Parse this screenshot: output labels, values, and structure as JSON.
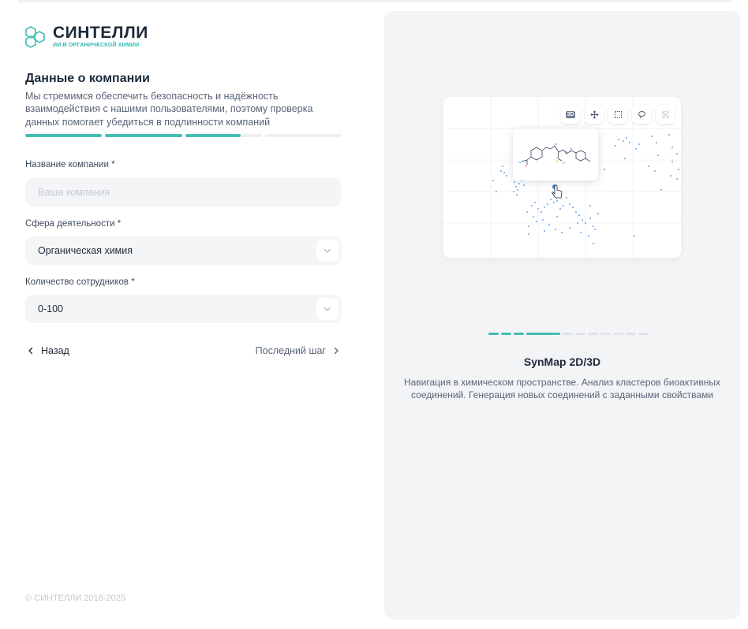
{
  "brand": {
    "name": "СИНТЕЛЛИ",
    "tagline": "ИИ В ОРГАНИЧЕСКОЙ ХИМИИ",
    "accent": "#43bdb2"
  },
  "form": {
    "title": "Данные о компании",
    "description": "Мы стремимся обеспечить безопасность и надёжность взаимодействия с нашими пользователями, поэтому проверка данных помогает убедиться в подлинности компаний",
    "progress": [
      1,
      1,
      0.73,
      0
    ],
    "company_name": {
      "label": "Название компании *",
      "placeholder": "Ваша компания",
      "value": ""
    },
    "industry": {
      "label": "Сфера деятельности *",
      "value": "Органическая химия"
    },
    "employees": {
      "label": "Количество сотрудников *",
      "value": "0-100"
    },
    "back_label": "Назад",
    "next_label": "Последний шаг"
  },
  "footer": {
    "copyright": "© СИНТЕЛЛИ 2018-2025"
  },
  "showcase": {
    "toolbar": {
      "badge_3d": "3D",
      "icons": [
        "3d-toggle-icon",
        "move-icon",
        "box-select-icon",
        "lasso-icon",
        "clear-selection-icon"
      ]
    },
    "carousel": {
      "total": 11,
      "active_index": 3
    },
    "title": "SynMap 2D/3D",
    "description": "Навигация в химическом пространстве. Анализ кластеров биоактивных соединений. Генерация новых соединений с заданными свойствами"
  }
}
